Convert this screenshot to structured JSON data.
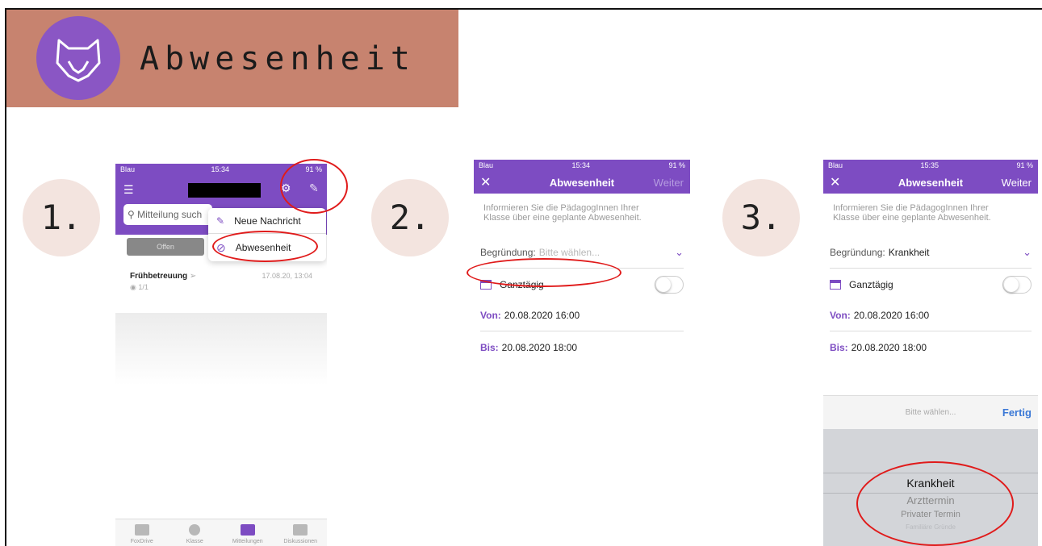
{
  "banner": {
    "title": "Abwesenheit"
  },
  "steps": [
    "1.",
    "2.",
    "3."
  ],
  "screen1": {
    "status": {
      "carrier": "Blau",
      "time": "15:34",
      "battery": "91 %"
    },
    "search_placeholder": "Mitteilung such",
    "segment_open": "Offen",
    "menu": {
      "new_message": "Neue Nachricht",
      "absence": "Abwesenheit"
    },
    "message": {
      "title": "Frühbetreuung",
      "date": "17.08.20, 13:04",
      "views": "1/1"
    },
    "tabs": [
      "FoxDrive",
      "Klasse",
      "Mitteilungen",
      "Diskussionen"
    ]
  },
  "screen2": {
    "status": {
      "carrier": "Blau",
      "time": "15:34",
      "battery": "91 %"
    },
    "nav_title": "Abwesenheit",
    "nav_right": "Weiter",
    "info": "Informieren Sie die PädagogInnen Ihrer Klasse über eine geplante Abwesenheit.",
    "reason_label": "Begründung:",
    "reason_placeholder": "Bitte wählen...",
    "allday": "Ganztägig",
    "from_label": "Von:",
    "from_value": "20.08.2020 16:00",
    "to_label": "Bis:",
    "to_value": "20.08.2020 18:00"
  },
  "screen3": {
    "status": {
      "carrier": "Blau",
      "time": "15:35",
      "battery": "91 %"
    },
    "nav_title": "Abwesenheit",
    "nav_right": "Weiter",
    "info": "Informieren Sie die PädagogInnen Ihrer Klasse über eine geplante Abwesenheit.",
    "reason_label": "Begründung:",
    "reason_value": "Krankheit",
    "allday": "Ganztägig",
    "from_label": "Von:",
    "from_value": "20.08.2020 16:00",
    "to_label": "Bis:",
    "to_value": "20.08.2020 18:00",
    "picker_placeholder": "Bitte wählen...",
    "picker_done": "Fertig",
    "picker_options": [
      "Krankheit",
      "Arzttermin",
      "Privater Termin",
      "Familiäre Gründe"
    ]
  },
  "colors": {
    "accent": "#7d4cc2",
    "banner": "#c7836f",
    "highlight": "#e01b1b"
  }
}
